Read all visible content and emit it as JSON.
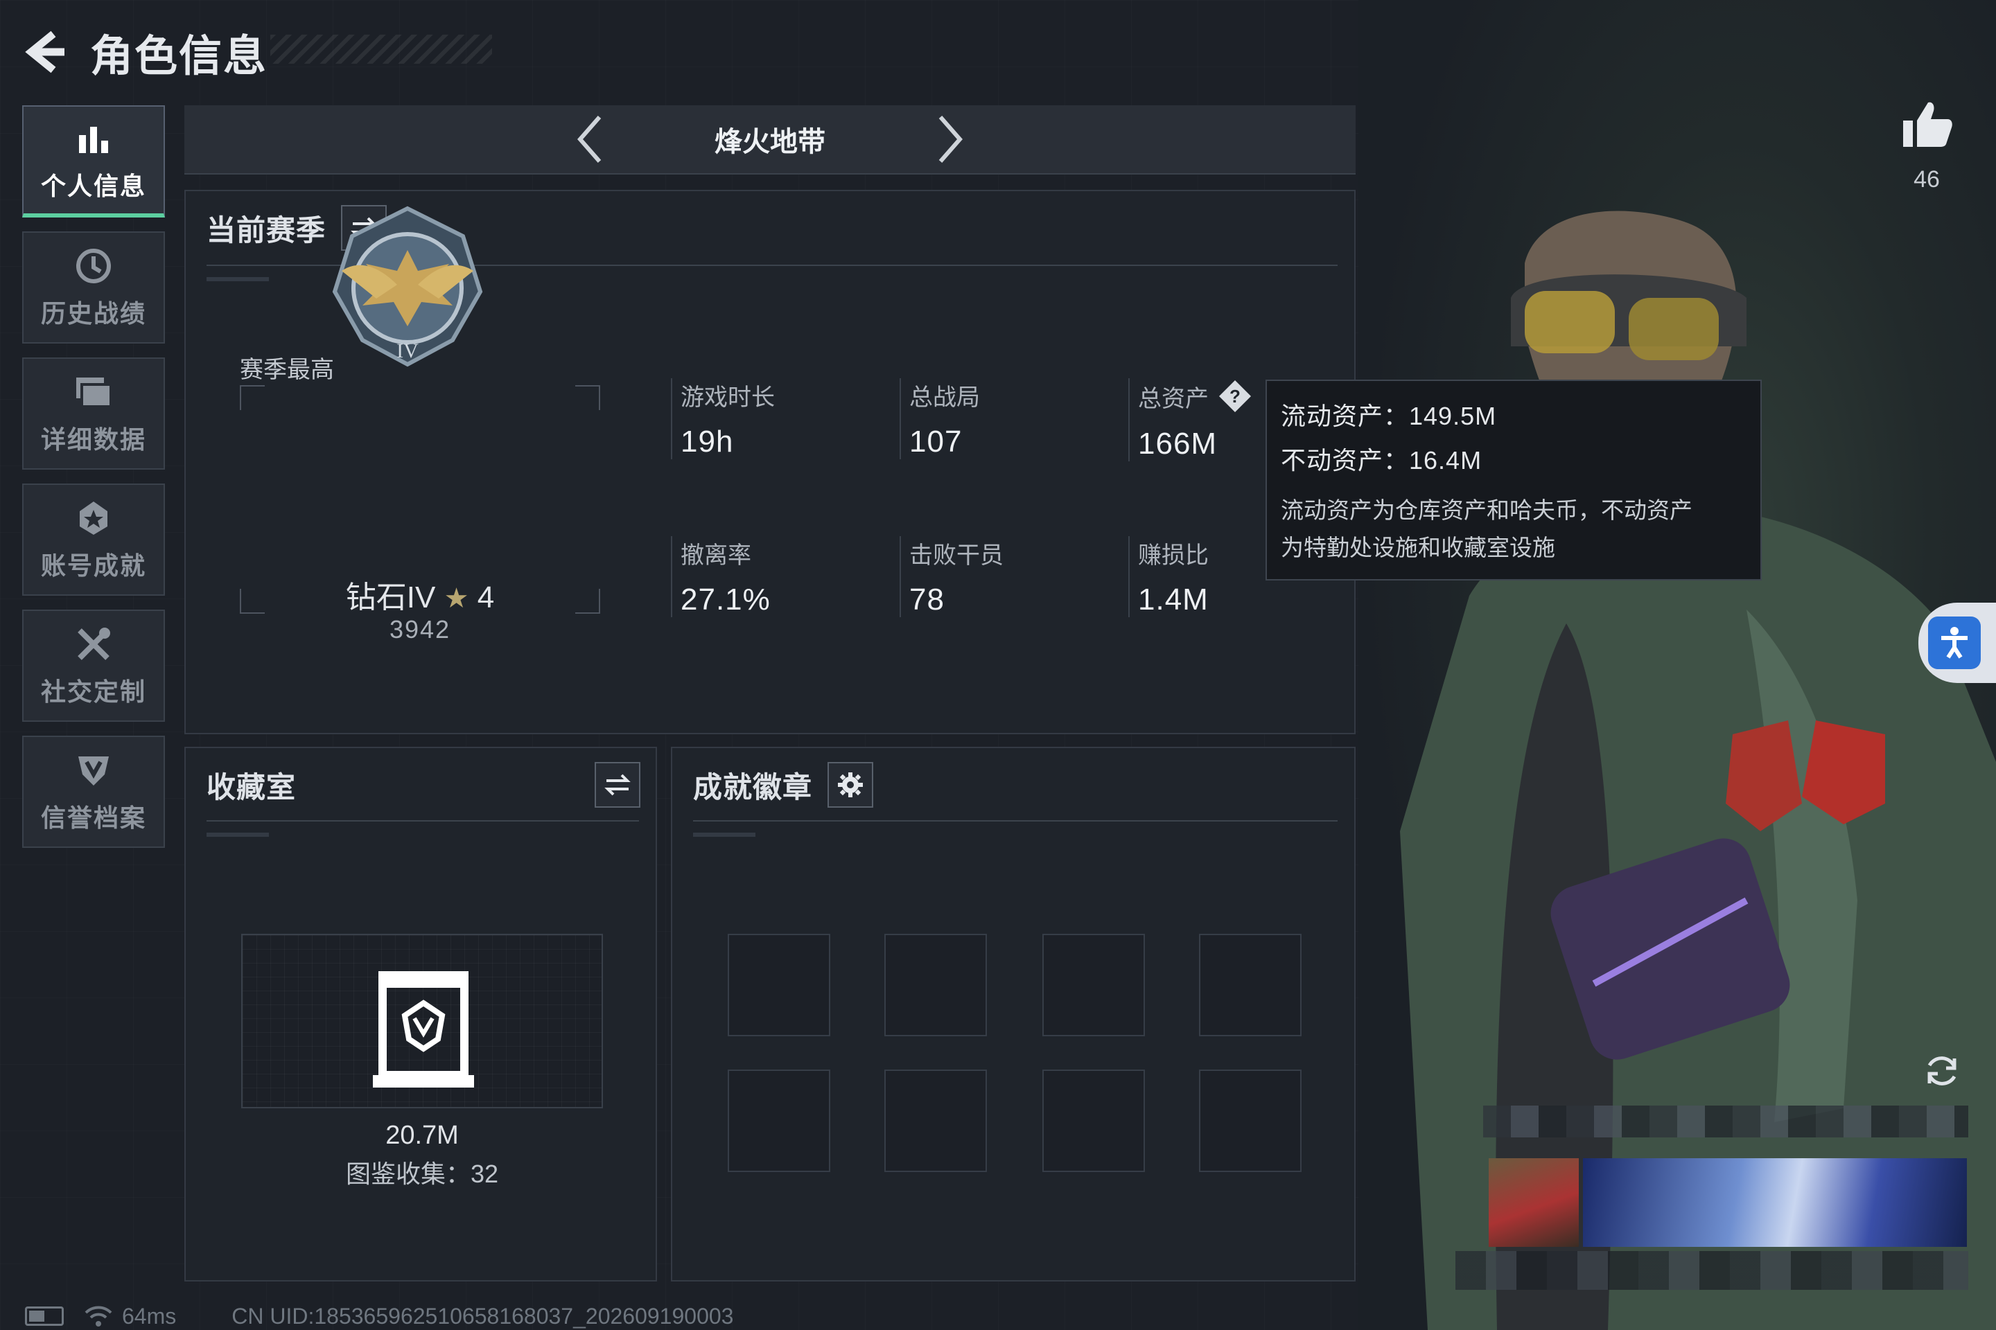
{
  "header": {
    "title": "角色信息"
  },
  "sidebar": {
    "items": [
      {
        "label": "个人信息",
        "icon": "bar-chart-icon",
        "active": true
      },
      {
        "label": "历史战绩",
        "icon": "history-clock-icon",
        "active": false
      },
      {
        "label": "详细数据",
        "icon": "folder-data-icon",
        "active": false
      },
      {
        "label": "账号成就",
        "icon": "achievement-star-icon",
        "active": false
      },
      {
        "label": "社交定制",
        "icon": "tools-icon",
        "active": false
      },
      {
        "label": "信誉档案",
        "icon": "shield-reputation-icon",
        "active": false
      }
    ]
  },
  "mode": {
    "title": "烽火地带"
  },
  "season": {
    "title": "当前赛季",
    "best_label": "赛季最高",
    "rank_name": "钻石IV",
    "rank_star_count": "4",
    "rank_score": "3942",
    "stats": [
      {
        "label": "游戏时长",
        "value": "19h"
      },
      {
        "label": "总战局",
        "value": "107"
      },
      {
        "label": "总资产",
        "value": "166M"
      },
      {
        "label": "撤离率",
        "value": "27.1%"
      },
      {
        "label": "击败干员",
        "value": "78"
      },
      {
        "label": "赚损比",
        "value": "1.4M"
      }
    ]
  },
  "tooltip": {
    "liquid": "流动资产：149.5M",
    "fixed": "不动资产：16.4M",
    "desc_line1": "流动资产为仓库资产和哈夫币，不动资产",
    "desc_line2": "为特勤处设施和收藏室设施"
  },
  "collection": {
    "title": "收藏室",
    "value": "20.7M",
    "count": "图鉴收集：32"
  },
  "badges": {
    "title": "成就徽章"
  },
  "likes": {
    "count": "46"
  },
  "footer": {
    "ping": "64ms",
    "uid": "CN UID:1853659625106581680​37_202609190003"
  },
  "colors": {
    "accent": "#5ccfa0",
    "a11y": "#2d73d8",
    "gold": "#b8a670"
  }
}
